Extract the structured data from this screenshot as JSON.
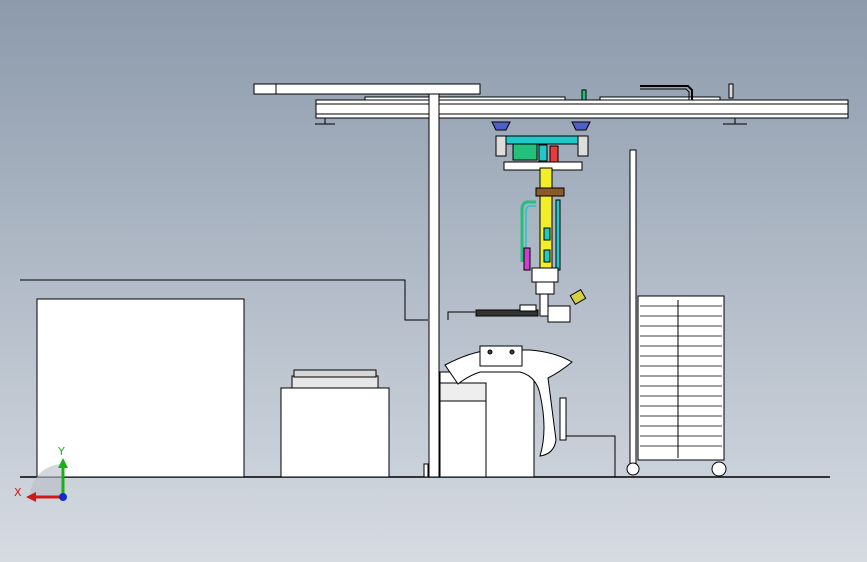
{
  "view": {
    "background_top": "#8c9aab",
    "background_bottom": "#d6dbe2"
  },
  "triad": {
    "x_label": "X",
    "y_label": "Y",
    "x_color": "#d01818",
    "y_color": "#18b018",
    "z_color": "#1828d0"
  },
  "colors": {
    "yellow_column": "#f2ef2a",
    "cyan_parts": "#20c8c8",
    "green_motor": "#22c07a",
    "magenta_part": "#d040d0",
    "red_part": "#e83a3a",
    "brown_clamp": "#8a5a2a",
    "blue_bracket": "#5060c8"
  }
}
